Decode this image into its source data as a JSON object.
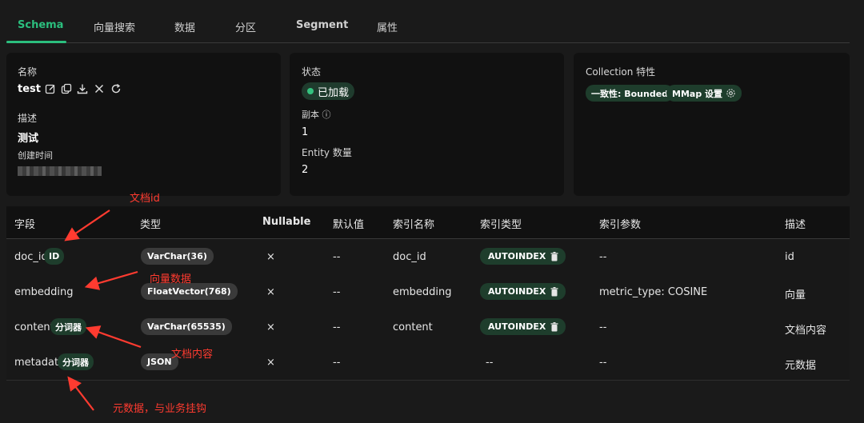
{
  "tabs": [
    {
      "label": "Schema"
    },
    {
      "label": "向量搜索"
    },
    {
      "label": "数据"
    },
    {
      "label": "分区"
    },
    {
      "label": "Segment"
    },
    {
      "label": "属性"
    }
  ],
  "info": {
    "name_label": "名称",
    "name_value": "test",
    "desc_label": "描述",
    "desc_value": "测试",
    "created_label": "创建时间",
    "status_label": "状态",
    "status_value": "已加载",
    "replica_label": "副本 ⓘ",
    "replica_value": "1",
    "entity_label": "Entity 数量",
    "entity_value": "2",
    "features_label": "Collection 特性",
    "consistency_chip": "一致性: Bounded",
    "mmap_chip": "MMap 设置"
  },
  "table": {
    "headers": [
      "字段",
      "类型",
      "Nullable",
      "默认值",
      "索引名称",
      "索引类型",
      "索引参数",
      "描述"
    ],
    "rows": [
      {
        "field": "doc_id",
        "badge": "ID",
        "type": "VarChar(36)",
        "nullable": "×",
        "default": "--",
        "index_name": "doc_id",
        "index_type": "AUTOINDEX",
        "index_params": "--",
        "desc": "id"
      },
      {
        "field": "embedding",
        "badge": "",
        "type": "FloatVector(768)",
        "nullable": "×",
        "default": "--",
        "index_name": "embedding",
        "index_type": "AUTOINDEX",
        "index_params": "metric_type: COSINE",
        "desc": "向量"
      },
      {
        "field": "content",
        "badge": "分词器",
        "type": "VarChar(65535)",
        "nullable": "×",
        "default": "--",
        "index_name": "content",
        "index_type": "AUTOINDEX",
        "index_params": "--",
        "desc": "文档内容"
      },
      {
        "field": "metadata",
        "badge": "分词器",
        "type": "JSON",
        "nullable": "×",
        "default": "--",
        "index_name": "--",
        "index_type": "",
        "index_params": "--",
        "desc": "元数据"
      }
    ]
  },
  "annotations": {
    "doc_id_note": "文档id",
    "vector_note": "向量数据",
    "content_note": "文档内容",
    "metadata_note": "元数据，与业务挂钩"
  },
  "colors": {
    "accent": "#2bbf7e",
    "annotation": "#ff3b30",
    "chip_bg": "#1e3d2c"
  }
}
